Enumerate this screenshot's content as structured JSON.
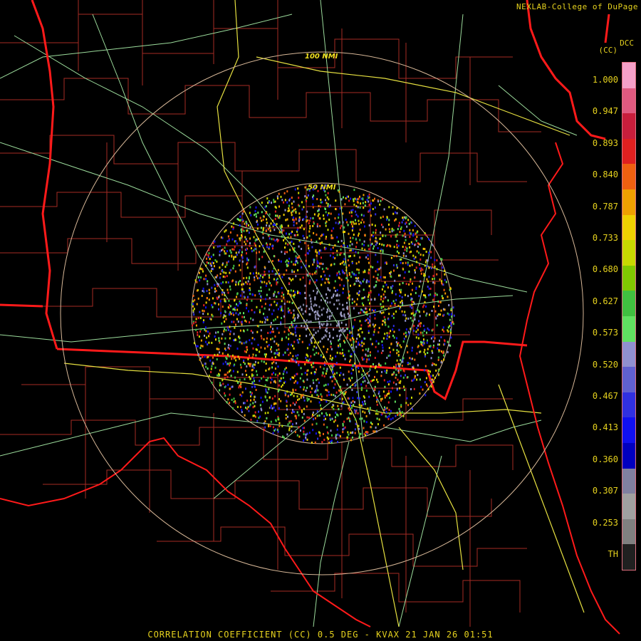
{
  "credit": "NEXLAB-College of DuPage",
  "units": {
    "top": "DCC",
    "sub": "(CC)"
  },
  "rings": [
    "100 NMI",
    "50 NMI"
  ],
  "scale": {
    "ticks": [
      "1.000",
      "0.947",
      "0.893",
      "0.840",
      "0.787",
      "0.733",
      "0.680",
      "0.627",
      "0.573",
      "0.520",
      "0.467",
      "0.413",
      "0.360",
      "0.307",
      "0.253",
      "TH"
    ],
    "colors": [
      "#f5a0c8",
      "#e05a80",
      "#c81e3c",
      "#e02020",
      "#f06010",
      "#f0a000",
      "#f0d000",
      "#c8d800",
      "#80c800",
      "#40c040",
      "#60e060",
      "#9090d0",
      "#6060d0",
      "#3030e0",
      "#1010f0",
      "#0000c0",
      "#8080a0",
      "#a0a0a0",
      "#808080",
      "#202020"
    ]
  },
  "footer": "CORRELATION COEFFICIENT (CC) 0.5 DEG - KVAX 21 JAN 26 01:51",
  "colors": {
    "text": "#e6d21e",
    "state_border": "#ff1a1a",
    "county": "#c0302a",
    "highway": "#9cdc9c",
    "interstate": "#e6e040",
    "ring": "#d8b898"
  }
}
